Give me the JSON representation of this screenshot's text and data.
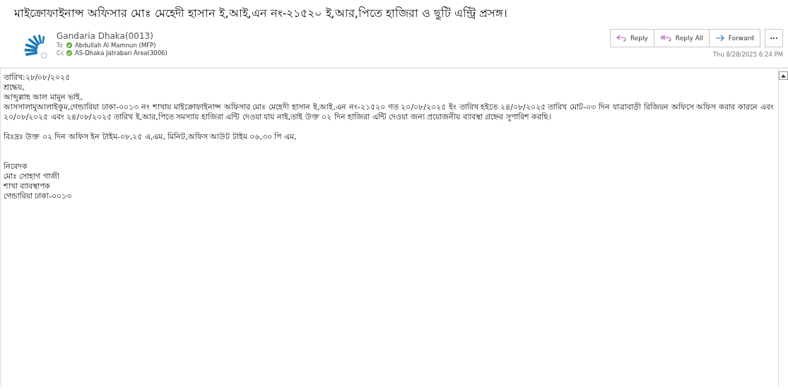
{
  "subject": "মাইক্রোফাইনান্স অফিসার মোঃ মেহেদী হাসান ই,আই,এন নং-২১৫২০ ই,আর,পিতে হাজিরা ও ছুটি এন্ট্রি  প্রসঙ্গ।",
  "sender": {
    "name": "Gandaria Dhaka(0013)"
  },
  "recipients": [
    {
      "label": "To",
      "name": "Abdullah Al Mamnun (MFP)",
      "verified": true
    },
    {
      "label": "Cc",
      "name": "AS-Dhaka Jatrabari Area(3006)",
      "verified": true
    }
  ],
  "actions": [
    {
      "kind": "reply",
      "label": "Reply"
    },
    {
      "kind": "reply_all",
      "label": "Reply All"
    },
    {
      "kind": "forward",
      "label": "Forward"
    }
  ],
  "more_button": "···",
  "timestamp": "Thu 8/28/2025 6:24 PM",
  "body": [
    {
      "kind": "line",
      "text": "তারিখ:২৮/০৮/২০২৫"
    },
    {
      "kind": "line",
      "text": "শ্রদ্ধেয়,"
    },
    {
      "kind": "line",
      "text": "আব্দুল্লাহ আল মামুন  ভাই,"
    },
    {
      "kind": "paragraph",
      "text": "আসসালামুআলাইকুম,গেন্ডারিয়া ঢাকা-০০১৩ নং শাখায়   মাইক্রোফাইনান্স  অফিসার  মোঃ মেহেদী হাসান  ই,আই,এন  নং-২১৫২০  গত  ২০/০৮/২০২৫  ইং  তারিখ হইতে ২৪/০৮/২০২৫ তারিখ মোট-০৩ দিন  যাত্রাবাড়ী রিজিয়ন অফিসে অফিস করার কারনে এবং ২০/০৮/২০২৫ এবং ২৪/০৮/২০২৫ তারিখ  ই,আর,পিতে সমস্যায় হাজিরা এন্টি দেওয়া যায় নাই,তাই উক্ত ০২ দিন  হাজিরা এন্টি দেওয়া জন্য প্রয়োজনীয় ব্যাবস্থা গ্রহ্নের সুপারিশ করছি।"
    },
    {
      "kind": "gap"
    },
    {
      "kind": "line",
      "text": "বিঃদ্রঃ উক্ত ০২ দিন অফিস ইন টাইম-০৮,২৫ এ,এম, মিনিট,অফিস  আউট টাইম ০৬,৩০ পি এম,"
    },
    {
      "kind": "gap"
    },
    {
      "kind": "gap"
    },
    {
      "kind": "line",
      "text": "নিবেদক"
    },
    {
      "kind": "line",
      "text": "মোঃ সোহাগ গাজী"
    },
    {
      "kind": "line",
      "text": "শাখা ব্যাবস্থাপক"
    },
    {
      "kind": "line",
      "text": "গেন্ডারিয়া ঢাকা-০০১৩"
    }
  ]
}
